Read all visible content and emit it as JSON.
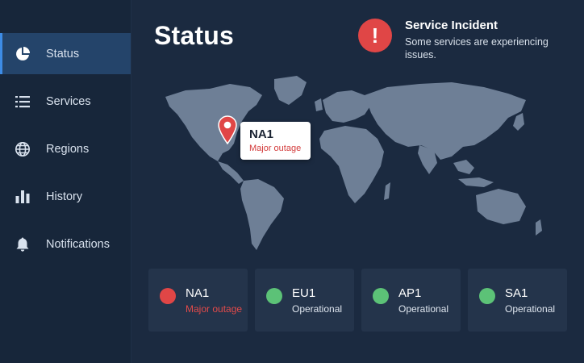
{
  "sidebar": {
    "items": [
      {
        "label": "Status",
        "icon": "pie-chart-icon",
        "active": true
      },
      {
        "label": "Services",
        "icon": "list-icon",
        "active": false
      },
      {
        "label": "Regions",
        "icon": "globe-icon",
        "active": false
      },
      {
        "label": "History",
        "icon": "bar-chart-icon",
        "active": false
      },
      {
        "label": "Notifications",
        "icon": "bell-icon",
        "active": false
      }
    ]
  },
  "header": {
    "title": "Status"
  },
  "incident": {
    "icon": "alert-icon",
    "title": "Service Incident",
    "message": "Some services are experiencing issues."
  },
  "map": {
    "callout": {
      "region": "NA1",
      "status": "Major outage"
    }
  },
  "regions": [
    {
      "name": "NA1",
      "status": "Major outage",
      "color": "#e04646"
    },
    {
      "name": "EU1",
      "status": "Operational",
      "color": "#5cc277"
    },
    {
      "name": "AP1",
      "status": "Operational",
      "color": "#5cc277"
    },
    {
      "name": "SA1",
      "status": "Operational",
      "color": "#5cc277"
    }
  ],
  "colors": {
    "background": "#1b2a40",
    "sidebar": "#17263a",
    "active_item": "#24446a",
    "accent": "#3d8ce6",
    "outage": "#e04646",
    "operational": "#5cc277",
    "landmass": "#6e7f96"
  }
}
